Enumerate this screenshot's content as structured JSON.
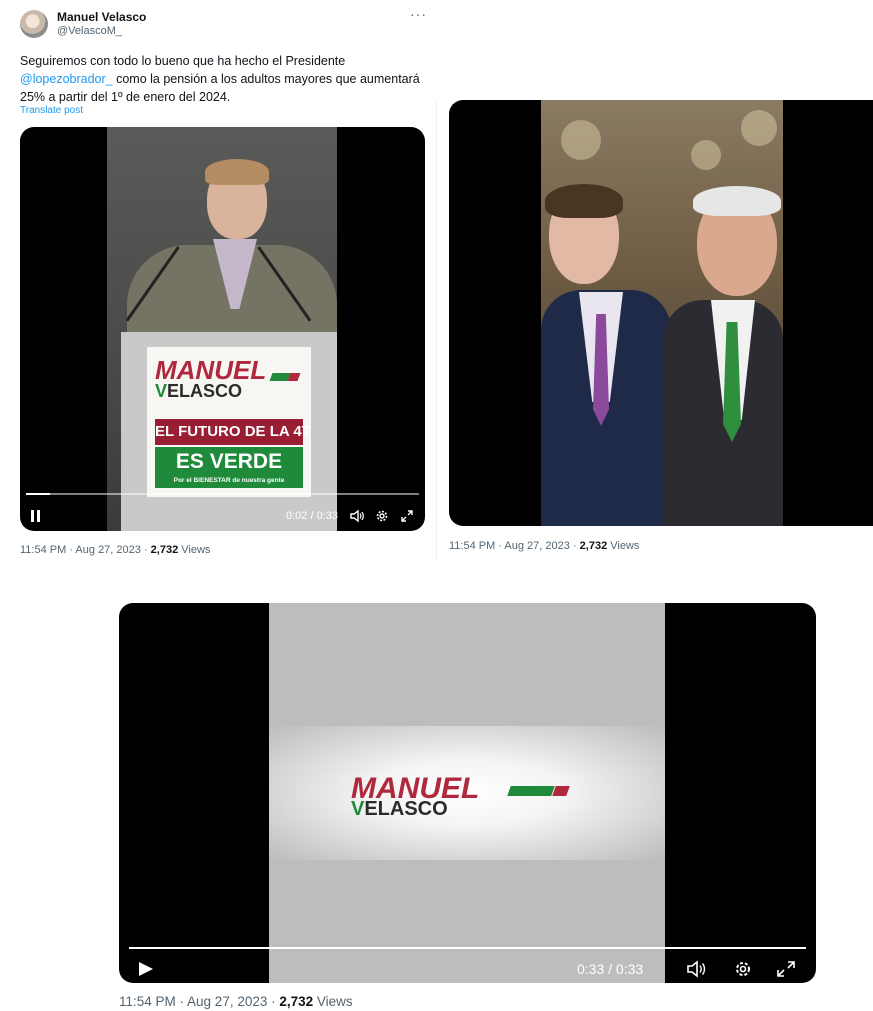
{
  "tweet": {
    "author_name": "Manuel Velasco",
    "author_handle": "@VelascoM_",
    "text_before": "Seguiremos con todo lo bueno que ha hecho el Presidente",
    "mention": "@lopezobrador_",
    "text_after": " como la pensión a los adultos mayores que aumentará 25% a partir del 1º de enero del 2024.",
    "translate_label": "Translate post",
    "more_icon": "more-horizontal-icon"
  },
  "video1": {
    "time": "0:02 / 0:33",
    "progress_fraction": 0.06,
    "sign_manuel": "MANUEL",
    "sign_velasco_v": "V",
    "sign_velasco_rest": "ELASCO",
    "sign_futuro": "EL FUTURO DE LA 4T",
    "sign_verde": "ES VERDE",
    "sign_bienestar": "Por el BIENESTAR de nuestra gente",
    "play_state_icon": "pause-icon"
  },
  "meta1": {
    "time_date": "11:54 PM · Aug 27, 2023 · ",
    "views_count": "2,732",
    "views_label": " Views"
  },
  "meta2": {
    "time_date": "11:54 PM · Aug 27, 2023 · ",
    "views_count": "2,732",
    "views_label": " Views"
  },
  "video3": {
    "time": "0:33 / 0:33",
    "progress_fraction": 1.0,
    "logo_manuel": "MANUEL",
    "logo_velasco_v": "V",
    "logo_velasco_rest": "ELASCO",
    "play_state_icon": "play-icon"
  },
  "meta3": {
    "time_date": "11:54 PM · Aug 27, 2023 · ",
    "views_count": "2,732",
    "views_label": " Views"
  },
  "colors": {
    "link": "#1d9bf0",
    "brand_red": "#b0283c",
    "brand_green": "#1e8a3a"
  }
}
